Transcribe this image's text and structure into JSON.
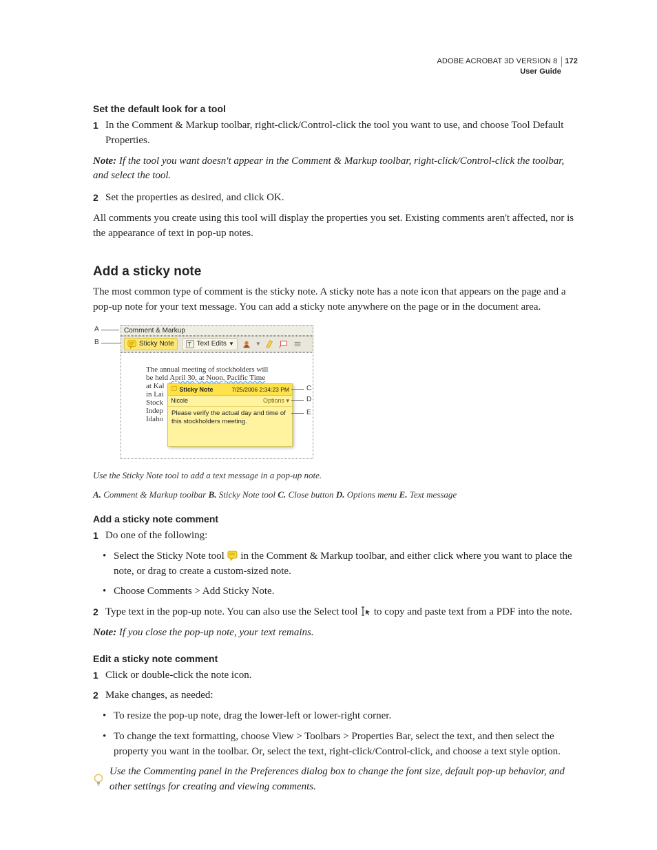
{
  "header": {
    "product": "ADOBE ACROBAT 3D VERSION 8",
    "guide": "User Guide",
    "page_number": "172"
  },
  "section1": {
    "heading": "Set the default look for a tool",
    "step1_num": "1",
    "step1": "In the Comment & Markup toolbar, right-click/Control-click the tool you want to use, and choose Tool Default Properties.",
    "note_label": "Note:",
    "note": " If the tool you want doesn't appear in the Comment & Markup toolbar, right-click/Control-click the toolbar, and select the tool.",
    "step2_num": "2",
    "step2": "Set the properties as desired, and click OK.",
    "para": "All comments you create using this tool will display the properties you set. Existing comments aren't affected, nor is the appearance of text in pop-up notes."
  },
  "section2": {
    "heading": "Add a sticky note",
    "intro": "The most common type of comment is the sticky note. A sticky note has a note icon that appears on the page and a pop-up note for your text message. You can add a sticky note anywhere on the page or in the document area."
  },
  "figure": {
    "labels": {
      "A": "A",
      "B": "B",
      "C": "C",
      "D": "D",
      "E": "E"
    },
    "toolbar_title": "Comment & Markup",
    "btn_sticky": "Sticky Note",
    "btn_textedits": "Text Edits",
    "doc_lines": {
      "l1": "The annual meeting of stockholders will",
      "l2_a": "be held ",
      "l2_b": "April 30, at Noon, Pacific Time",
      "l3": "at Kal",
      "l4": "in Lai",
      "l5": "Stock",
      "l6": "Indep",
      "l7": "Idaho"
    },
    "popup": {
      "title": "Sticky Note",
      "timestamp": "7/25/2006 2:34:23 PM",
      "author": "Nicole",
      "options": "Options ▾",
      "message": "Please verify the actual day and time of this stockholders meeting."
    },
    "caption_line1": "Use the Sticky Note tool to add a text message in a pop-up note.",
    "caption_keys": {
      "A": "A.",
      "A_txt": " Comment & Markup toolbar  ",
      "B": "B.",
      "B_txt": " Sticky Note tool  ",
      "C": "C.",
      "C_txt": " Close button  ",
      "D": "D.",
      "D_txt": " Options menu  ",
      "E": "E.",
      "E_txt": " Text message"
    }
  },
  "section3": {
    "heading": "Add a sticky note comment",
    "step1_num": "1",
    "step1": "Do one of the following:",
    "bullet1_a": "Select the Sticky Note tool ",
    "bullet1_b": " in the Comment & Markup toolbar, and either click where you want to place the note, or drag to create a custom-sized note.",
    "bullet2": "Choose Comments > Add Sticky Note.",
    "step2_num": "2",
    "step2_a": "Type text in the pop-up note. You can also use the Select tool ",
    "step2_b": " to copy and paste text from a PDF into the note.",
    "note_label": "Note:",
    "note": " If you close the pop-up note, your text remains."
  },
  "section4": {
    "heading": "Edit a sticky note comment",
    "step1_num": "1",
    "step1": "Click or double-click the note icon.",
    "step2_num": "2",
    "step2": "Make changes, as needed:",
    "bullet1": "To resize the pop-up note, drag the lower-left or lower-right corner.",
    "bullet2": "To change the text formatting, choose View > Toolbars > Properties Bar, select the text, and then select the property you want in the toolbar. Or, select the text, right-click/Control-click, and choose a text style option.",
    "tip": "Use the Commenting panel in the Preferences dialog box to change the font size, default pop-up behavior, and other settings for creating and viewing comments."
  }
}
